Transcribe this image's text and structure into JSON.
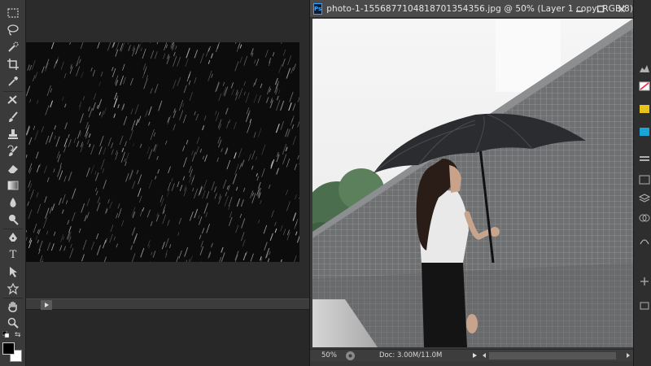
{
  "document": {
    "app_badge": "Ps",
    "title": "photo-1-1556877104818701354356.jpg @ 50% (Layer 1 copy, RGB/8) *"
  },
  "status": {
    "zoom": "50%",
    "doc_size": "Doc: 3.00M/11.0M"
  },
  "toolbar": {
    "type_tool_label": "T",
    "icons": [
      "marquee-icon",
      "lasso-icon",
      "quick-select-icon",
      "crop-icon",
      "eyedropper-icon",
      "healing-brush-icon",
      "brush-icon",
      "clone-stamp-icon",
      "history-brush-icon",
      "eraser-icon",
      "gradient-icon",
      "blur-icon",
      "dodge-icon",
      "pen-icon",
      "type-icon",
      "path-select-icon",
      "shape-icon",
      "hand-icon",
      "zoom-icon"
    ]
  },
  "colors": {
    "foreground": "#000000",
    "background": "#ffffff",
    "accent": "#31a8ff"
  }
}
